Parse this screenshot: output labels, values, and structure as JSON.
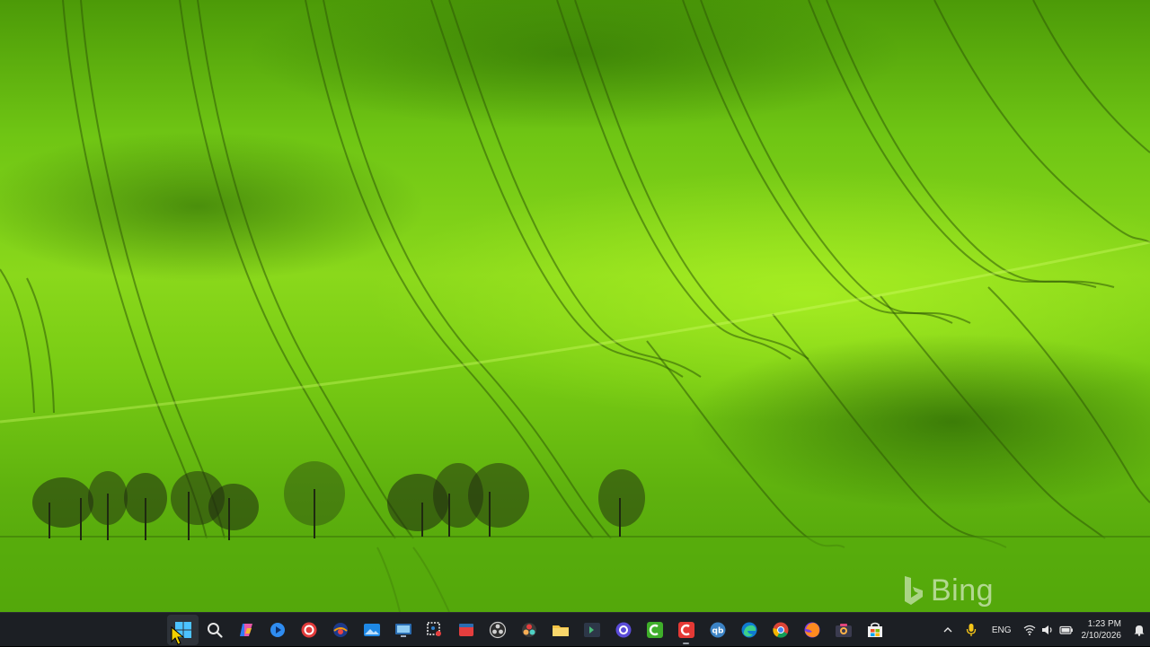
{
  "desktop": {
    "wallpaper": "rolling green wheat field with tree line",
    "watermark_text": "Bing"
  },
  "taskbar": {
    "apps": [
      {
        "name": "start-button",
        "icon": "windows-logo-icon",
        "active": true,
        "running": false
      },
      {
        "name": "search-button",
        "icon": "search-icon",
        "active": false,
        "running": false
      },
      {
        "name": "copilot-button",
        "icon": "copilot-icon",
        "active": false,
        "running": false
      },
      {
        "name": "app-blue-circle",
        "icon": "blue-play-icon",
        "active": false,
        "running": false
      },
      {
        "name": "app-screen-recorder",
        "icon": "record-icon",
        "active": false,
        "running": false
      },
      {
        "name": "app-vpn",
        "icon": "shield-globe-icon",
        "active": false,
        "running": false
      },
      {
        "name": "app-photos",
        "icon": "photos-icon",
        "active": false,
        "running": false
      },
      {
        "name": "app-remote-desktop",
        "icon": "remote-desktop-icon",
        "active": false,
        "running": false
      },
      {
        "name": "app-snipping-tool",
        "icon": "snipping-tool-icon",
        "active": false,
        "running": false
      },
      {
        "name": "app-red-box",
        "icon": "red-app-icon",
        "active": false,
        "running": false
      },
      {
        "name": "app-obs",
        "icon": "obs-icon",
        "active": false,
        "running": false
      },
      {
        "name": "app-davinci",
        "icon": "davinci-icon",
        "active": false,
        "running": false
      },
      {
        "name": "app-file-explorer",
        "icon": "folder-icon",
        "active": false,
        "running": false
      },
      {
        "name": "app-terminal-green",
        "icon": "terminal-icon",
        "active": false,
        "running": false
      },
      {
        "name": "app-purple-circle",
        "icon": "purple-circle-icon",
        "active": false,
        "running": false
      },
      {
        "name": "app-camtasia-green",
        "icon": "camtasia-green-icon",
        "active": false,
        "running": false
      },
      {
        "name": "app-camtasia-red",
        "icon": "camtasia-red-icon",
        "active": false,
        "running": true
      },
      {
        "name": "app-qbittorrent",
        "icon": "qbittorrent-icon",
        "active": false,
        "running": false
      },
      {
        "name": "app-edge",
        "icon": "edge-icon",
        "active": false,
        "running": false
      },
      {
        "name": "app-chrome",
        "icon": "chrome-icon",
        "active": false,
        "running": false
      },
      {
        "name": "app-firefox",
        "icon": "firefox-icon",
        "active": false,
        "running": false
      },
      {
        "name": "app-camera-tool",
        "icon": "camera-icon",
        "active": false,
        "running": false
      },
      {
        "name": "app-store",
        "icon": "store-icon",
        "active": false,
        "running": false
      }
    ]
  },
  "tray": {
    "language": "ENG",
    "time": "1:23 PM",
    "date": "2/10/2026"
  },
  "colors": {
    "taskbar_bg": "#1c1f24",
    "field_green": "#8ad81b"
  }
}
